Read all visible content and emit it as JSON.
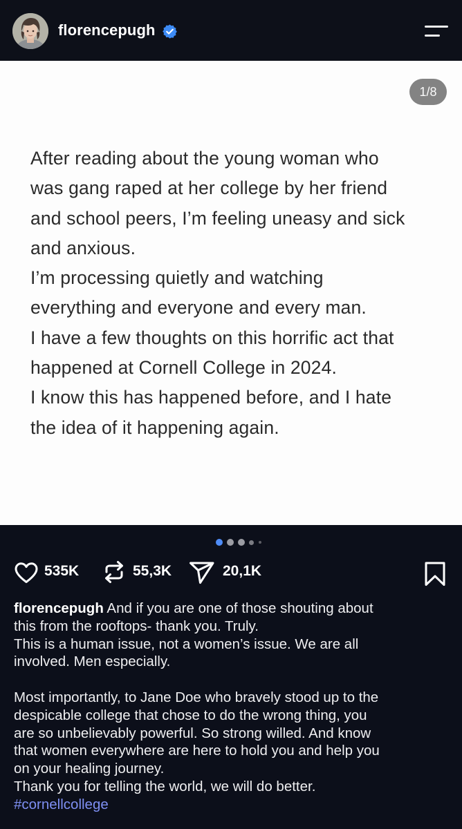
{
  "header": {
    "username": "florencepugh",
    "verified_icon": "verified-badge-icon",
    "menu_icon": "hamburger-menu-icon"
  },
  "slide": {
    "counter": "1/8",
    "lines": [
      "After reading about the young woman who",
      "was gang raped at her college by her friend",
      "and school peers, I’m feeling uneasy and sick",
      "and anxious.",
      "I’m processing quietly and watching",
      "everything and everyone and every man.",
      "I have a few thoughts on this horrific act that",
      "happened at Cornell College in 2024.",
      "I know this has happened before, and I hate",
      "the idea of it happening again."
    ]
  },
  "carousel": {
    "total_visible_dots": 5,
    "active_index": 0
  },
  "actions": {
    "likes": "535K",
    "reposts": "55,3K",
    "shares": "20,1K"
  },
  "caption": {
    "username": "florencepugh",
    "line1_rest": " And if you are one of those shouting about",
    "lines": [
      "this from the rooftops- thank you. Truly.",
      "This is a human issue, not a women’s issue. We are all",
      "involved. Men especially."
    ],
    "lines2": [
      "Most importantly, to Jane Doe who bravely stood up to the",
      "despicable college that chose to do the wrong thing, you",
      "are so unbelievably powerful. So strong willed. And know",
      "that women everywhere are here to hold you and help you",
      "on your healing journey.",
      "Thank you for telling the world, we will do better."
    ],
    "hashtag": "#cornellcollege"
  },
  "colors": {
    "background": "#0c0f1a",
    "slide_bg": "#fdfdfd",
    "verified": "#3d8bf5",
    "hashtag": "#7e8ff2",
    "active_dot": "#4f8cf7"
  }
}
